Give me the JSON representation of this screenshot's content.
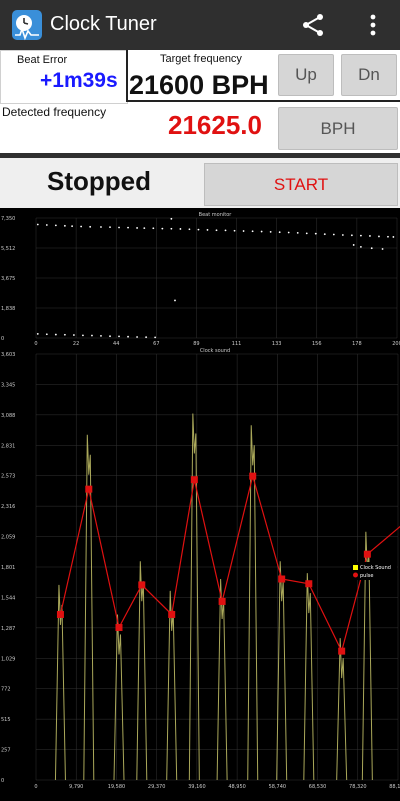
{
  "app": {
    "title": "Clock Tuner",
    "icons": [
      "clock-tuner-app-icon",
      "share-icon",
      "more-options-icon"
    ]
  },
  "beat_error": {
    "label": "Beat Error",
    "value": "+1m39s"
  },
  "target_frequency": {
    "label": "Target frequency",
    "value": "21600 BPH",
    "up_label": "Up",
    "down_label": "Dn"
  },
  "detected_frequency": {
    "label": "Detected frequency",
    "value": "21625.0",
    "unit_button": "BPH"
  },
  "status": {
    "text": "Stopped",
    "start_label": "START"
  },
  "colors": {
    "beat_error": "#1a1aff",
    "detected": "#e01111",
    "start": "#e01111",
    "pulse": "#e01111",
    "clock_sound": "#c8c66a"
  },
  "chart_data": [
    {
      "type": "scatter",
      "title": "Beat monitor",
      "x_ticks": [
        "0",
        "22",
        "44",
        "67",
        "89",
        "111",
        "133",
        "156",
        "178",
        "200"
      ],
      "y_ticks": [
        "0",
        "1,838",
        "3,675",
        "5,512",
        "7,350"
      ],
      "xlim": [
        0,
        200
      ],
      "ylim": [
        0,
        7350
      ],
      "series": [
        {
          "points": [
            [
              1,
              6950
            ],
            [
              6,
              6920
            ],
            [
              11,
              6900
            ],
            [
              16,
              6870
            ],
            [
              20,
              6850
            ],
            [
              25,
              6830
            ],
            [
              30,
              6810
            ],
            [
              36,
              6800
            ],
            [
              41,
              6790
            ],
            [
              46,
              6770
            ],
            [
              51,
              6760
            ],
            [
              56,
              6740
            ],
            [
              60,
              6730
            ],
            [
              65,
              6720
            ],
            [
              70,
              6700
            ],
            [
              75,
              6690
            ],
            [
              80,
              6680
            ],
            [
              85,
              6660
            ],
            [
              90,
              6640
            ],
            [
              95,
              6620
            ],
            [
              100,
              6600
            ],
            [
              105,
              6590
            ],
            [
              110,
              6570
            ],
            [
              115,
              6550
            ],
            [
              120,
              6540
            ],
            [
              125,
              6520
            ],
            [
              130,
              6500
            ],
            [
              135,
              6480
            ],
            [
              140,
              6460
            ],
            [
              145,
              6440
            ],
            [
              150,
              6410
            ],
            [
              155,
              6390
            ],
            [
              160,
              6360
            ],
            [
              165,
              6340
            ],
            [
              170,
              6310
            ],
            [
              175,
              6290
            ],
            [
              180,
              6270
            ],
            [
              185,
              6250
            ],
            [
              190,
              6220
            ],
            [
              195,
              6200
            ],
            [
              198,
              6190
            ]
          ]
        },
        {
          "points": [
            [
              1,
              250
            ],
            [
              6,
              230
            ],
            [
              11,
              210
            ],
            [
              16,
              200
            ],
            [
              21,
              180
            ],
            [
              26,
              160
            ],
            [
              31,
              150
            ],
            [
              36,
              130
            ],
            [
              41,
              110
            ],
            [
              46,
              100
            ],
            [
              51,
              80
            ],
            [
              56,
              60
            ],
            [
              61,
              50
            ],
            [
              66,
              40
            ]
          ]
        },
        {
          "points": [
            [
              75,
              7300
            ],
            [
              77,
              2300
            ],
            [
              176,
              5700
            ],
            [
              180,
              5580
            ],
            [
              186,
              5500
            ],
            [
              192,
              5450
            ]
          ]
        }
      ]
    },
    {
      "type": "line",
      "title": "Clock sound",
      "legend": [
        "Clock Sound",
        "pulse"
      ],
      "legend_position": "right",
      "x_ticks": [
        "0",
        "9,790",
        "19,580",
        "29,370",
        "39,160",
        "48,950",
        "58,740",
        "68,530",
        "78,320",
        "88,110"
      ],
      "y_ticks": [
        "0",
        "257",
        "515",
        "772",
        "1,029",
        "1,287",
        "1,544",
        "1,801",
        "2,059",
        "2,316",
        "2,573",
        "2,831",
        "3,088",
        "3,345",
        "3,603"
      ],
      "xlim": [
        0,
        88110
      ],
      "ylim": [
        0,
        3603
      ],
      "series": [
        {
          "name": "pulse",
          "x": [
            5950,
            12850,
            20200,
            25750,
            33030,
            38540,
            45300,
            52750,
            59800,
            66400,
            74400,
            80650
          ],
          "y": [
            1400,
            2460,
            1290,
            1650,
            1400,
            2540,
            1510,
            2570,
            1700,
            1660,
            1090,
            1910
          ]
        },
        {
          "name": "Clock Sound",
          "x": [
            5950,
            12850,
            20200,
            25750,
            33030,
            38540,
            45300,
            52750,
            59800,
            66400,
            74400,
            80650
          ],
          "y": [
            1650,
            2920,
            1400,
            1850,
            1600,
            3100,
            1700,
            3000,
            1850,
            1750,
            1200,
            2100
          ]
        }
      ]
    }
  ]
}
